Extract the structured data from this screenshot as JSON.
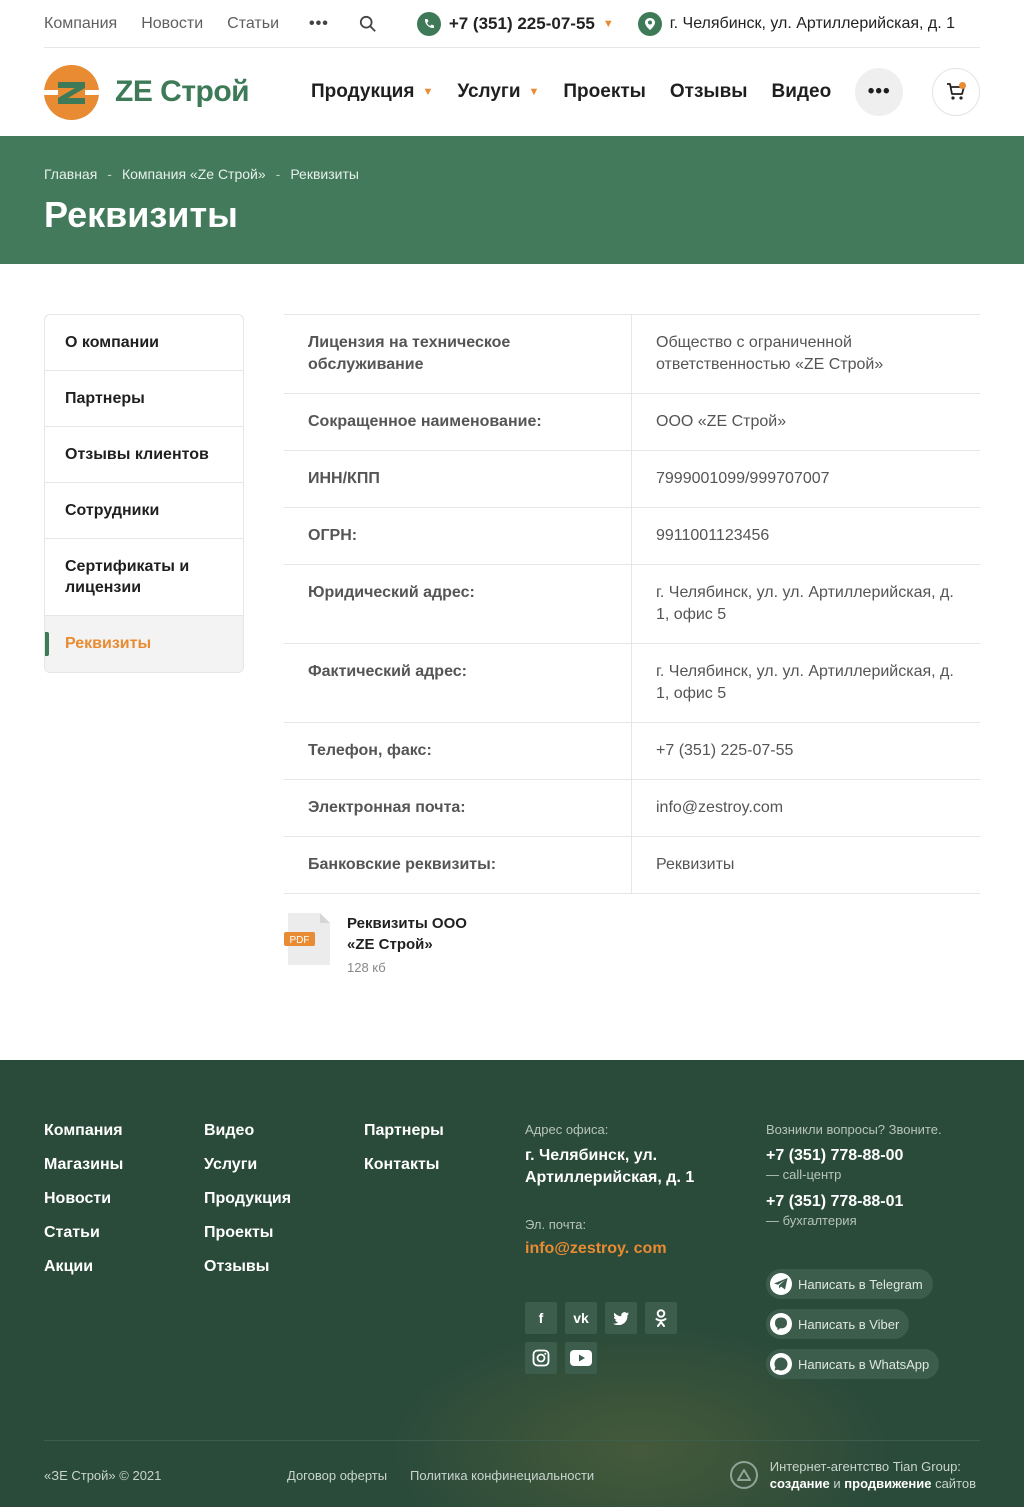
{
  "topbar": {
    "links": [
      "Компания",
      "Новости",
      "Статьи"
    ],
    "phone": "+7 (351) 225-07-55",
    "address": "г. Челябинск, ул. Артиллерийская, д. 1"
  },
  "header": {
    "logo": "ZE Строй",
    "nav": [
      "Продукция",
      "Услуги",
      "Проекты",
      "Отзывы",
      "Видео"
    ]
  },
  "banner": {
    "breadcrumbs": [
      "Главная",
      "Компания «Ze Строй»",
      "Реквизиты"
    ],
    "title": "Реквизиты"
  },
  "side_menu": [
    "О компании",
    "Партнеры",
    "Отзывы клиентов",
    "Сотрудники",
    "Сертификаты и лицензии",
    "Реквизиты"
  ],
  "requisites": [
    {
      "key": "Лицензия на техническое обслуживание",
      "value": "Общество с ограниченной ответственностью «ZE Строй»"
    },
    {
      "key": "Сокращенное наименование:",
      "value": "ООО «ZE Строй»"
    },
    {
      "key": "ИНН/КПП",
      "value": "7999001099/999707007"
    },
    {
      "key": "ОГРН:",
      "value": "9911001123456"
    },
    {
      "key": "Юридический адрес:",
      "value": "г. Челябинск, ул. ул. Артиллерийская, д. 1, офис 5"
    },
    {
      "key": "Фактический адрес:",
      "value": "г. Челябинск, ул. ул. Артиллерийская, д. 1, офис 5"
    },
    {
      "key": "Телефон, факс:",
      "value": "+7 (351) 225-07-55"
    },
    {
      "key": "Электронная почта:",
      "value": "info@zestroy.com"
    },
    {
      "key": "Банковские реквизиты:",
      "value": "Реквизиты"
    }
  ],
  "file": {
    "badge": "PDF",
    "name": "Реквизиты ООО «ZE Строй»",
    "size": "128 кб"
  },
  "footer": {
    "col1": [
      "Компания",
      "Магазины",
      "Новости",
      "Статьи",
      "Акции"
    ],
    "col2": [
      "Видео",
      "Услуги",
      "Продукция",
      "Проекты",
      "Отзывы"
    ],
    "col3": [
      "Партнеры",
      "Контакты"
    ],
    "office_label": "Адрес офиса:",
    "office_address": "г. Челябинск, ул. Артиллерийская, д. 1",
    "email_label": "Эл. почта:",
    "email": "info@zestroy. com",
    "questions_label": "Возникли вопросы? Звоните.",
    "phone1": "+7 (351) 778-88-00",
    "phone1_note": "— call-центр",
    "phone2": "+7 (351) 778-88-01",
    "phone2_note": "— бухгалтерия",
    "messengers": [
      "Написать в Telegram",
      "Написать в Viber",
      "Написать в WhatsApp"
    ],
    "copyright": "«ЗЕ Строй» © 2021",
    "offer": "Договор оферты",
    "privacy": "Политика конфинециальности",
    "agency_line1": "Интернет-агентство Tian Group:",
    "agency_w1": "создание",
    "agency_and": "и",
    "agency_w2": "продвижение",
    "agency_w3": "сайтов"
  },
  "colors": {
    "green": "#437a5b",
    "orange": "#e88b32",
    "footer": "#2a4a3a"
  }
}
